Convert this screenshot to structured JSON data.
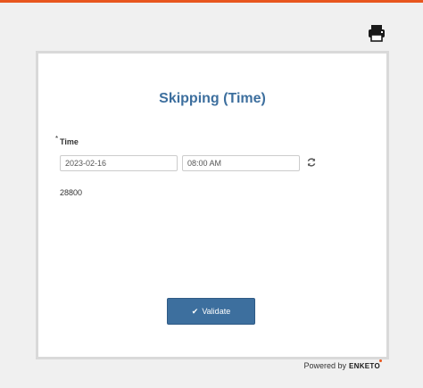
{
  "form": {
    "title": "Skipping (Time)",
    "question": {
      "required_mark": "*",
      "label": "Time",
      "date_value": "2023-02-16",
      "time_value": "08:00 AM",
      "output": "28800"
    },
    "validate_label": "Validate"
  },
  "footer": {
    "powered_by": "Powered by",
    "brand": "ENKETO"
  },
  "icons": {
    "print": "print-icon",
    "reset": "refresh-icon",
    "validate": "check-icon"
  },
  "colors": {
    "accent_top_bar": "#e8561e",
    "title": "#3d6f9e",
    "button": "#3d6f9e"
  }
}
